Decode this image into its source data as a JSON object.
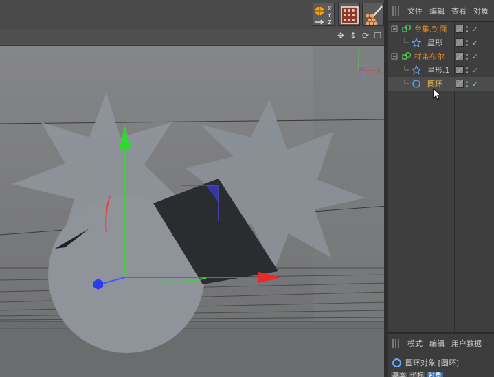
{
  "toolbar": {
    "tools": [
      {
        "name": "xyz-axis-tool",
        "label_x": "X",
        "label_y": "Y",
        "label_z": "Z"
      },
      {
        "name": "texture-tool"
      },
      {
        "name": "sculpt-brush-tool"
      }
    ]
  },
  "viewport": {
    "axis_gizmo": {
      "y": "Y",
      "z": "Z",
      "x": "X"
    }
  },
  "object_manager": {
    "menu": [
      "文件",
      "编辑",
      "查看",
      "对象"
    ],
    "objects": [
      {
        "name": "台集.封面",
        "color": "#e08a2b",
        "indent": 0,
        "icon": "connect-object-icon",
        "enabled": true
      },
      {
        "name": "星形",
        "color": "#c8c8c8",
        "indent": 1,
        "icon": "star-spline-icon",
        "enabled": true
      },
      {
        "name": "样条布尔",
        "color": "#e08a2b",
        "indent": 0,
        "icon": "spline-boolean-icon",
        "enabled": true
      },
      {
        "name": "星形.1",
        "color": "#c8c8c8",
        "indent": 1,
        "icon": "star-spline-icon",
        "enabled": true
      },
      {
        "name": "圆环",
        "color": "#f0c040",
        "indent": 1,
        "icon": "circle-spline-icon",
        "enabled": true,
        "selected": true
      }
    ]
  },
  "attribute_manager": {
    "menu": [
      "模式",
      "编辑",
      "用户数据"
    ],
    "title": "圆环对象 [圆环]",
    "tabs": [
      "基本",
      "坐标",
      "对象"
    ],
    "active_tab": "对象"
  },
  "colors": {
    "accent": "#3f6fa8",
    "orange_object": "#e08a2b",
    "selected_object": "#f0c040",
    "check": "#6fd36f"
  }
}
